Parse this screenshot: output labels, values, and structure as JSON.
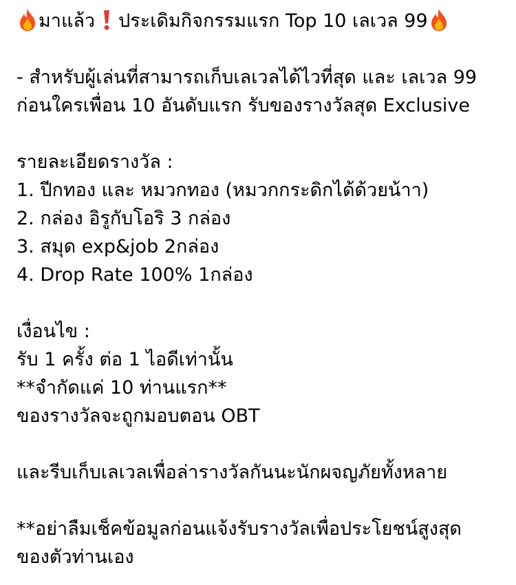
{
  "colors": {
    "background": "#ffffff",
    "text": "#000000",
    "fire_outer": "#f4511e",
    "fire_inner": "#ffb300",
    "exclamation": "#e53935"
  },
  "header": {
    "leading_icon": "fire-icon",
    "part1": "มาแล้ว",
    "mid_icon": "red-exclamation-icon",
    "part2": "ประเดิมกิจกรรมแรก Top 10 เลเวล 99",
    "trailing_icon": "fire-icon"
  },
  "intro": [
    "- สำหรับผู้เล่นที่สามารถเก็บเลเวลได้ไวที่สุด และ เลเวล 99",
    "ก่อนใครเพื่อน 10 อันดับแรก รับของรางวัลสุด Exclusive"
  ],
  "rewards": {
    "heading": "รายละเอียดรางวัล :",
    "items": [
      "1. ปีกทอง และ หมวกทอง (หมวกกระดิกได้ด้วยน้าา)",
      "2. กล่อง อิรูกับโอริ 3 กล่อง",
      "3. สมุด exp&job 2กล่อง",
      "4. Drop Rate 100% 1กล่อง"
    ]
  },
  "conditions": {
    "heading": "เงื่อนไข :",
    "items": [
      "รับ 1 ครั้ง ต่อ 1 ไอดีเท่านั้น",
      "**จำกัดแค่ 10 ท่านแรก**",
      "ของรางวัลจะถูกมอบตอน OBT"
    ]
  },
  "call_to_action": "และรีบเก็บเลเวลเพื่อล่ารางวัลกันนะนักผจญภัยทั้งหลาย",
  "reminder": [
    "**อย่าลืมเช็คข้อมูลก่อนแจ้งรับรางวัลเพื่อประโยชน์สูงสุด",
    "ของตัวท่านเอง"
  ]
}
